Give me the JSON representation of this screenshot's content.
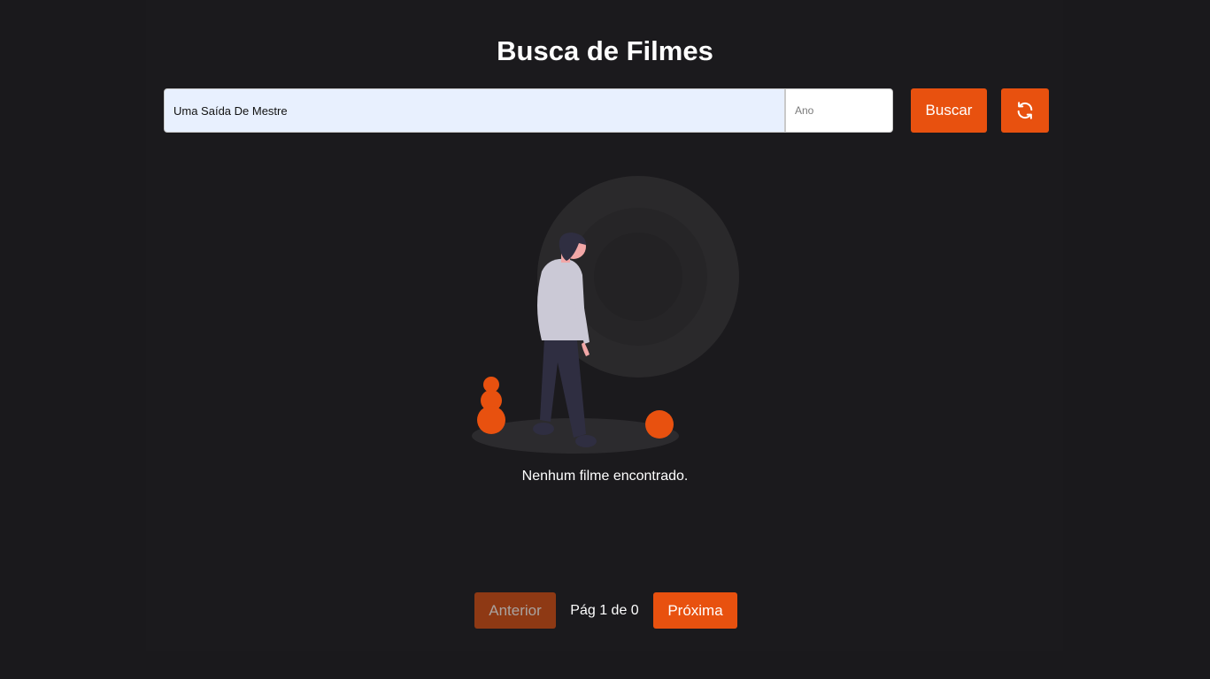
{
  "header": {
    "title": "Busca de Filmes"
  },
  "search": {
    "query_value": "Uma Saída De Mestre",
    "year_placeholder": "Ano",
    "search_button_label": "Buscar",
    "refresh_icon": "refresh-icon"
  },
  "results": {
    "empty_message": "Nenhum filme encontrado.",
    "illustration": "person-walking-empty-state"
  },
  "pagination": {
    "prev_label": "Anterior",
    "page_label": "Pág 1 de 0",
    "next_label": "Próxima",
    "prev_disabled": true
  },
  "colors": {
    "background": "#1a191c",
    "accent": "#e8510f",
    "accent_disabled": "#8e3914",
    "input_autofill": "#e8f0fe"
  }
}
